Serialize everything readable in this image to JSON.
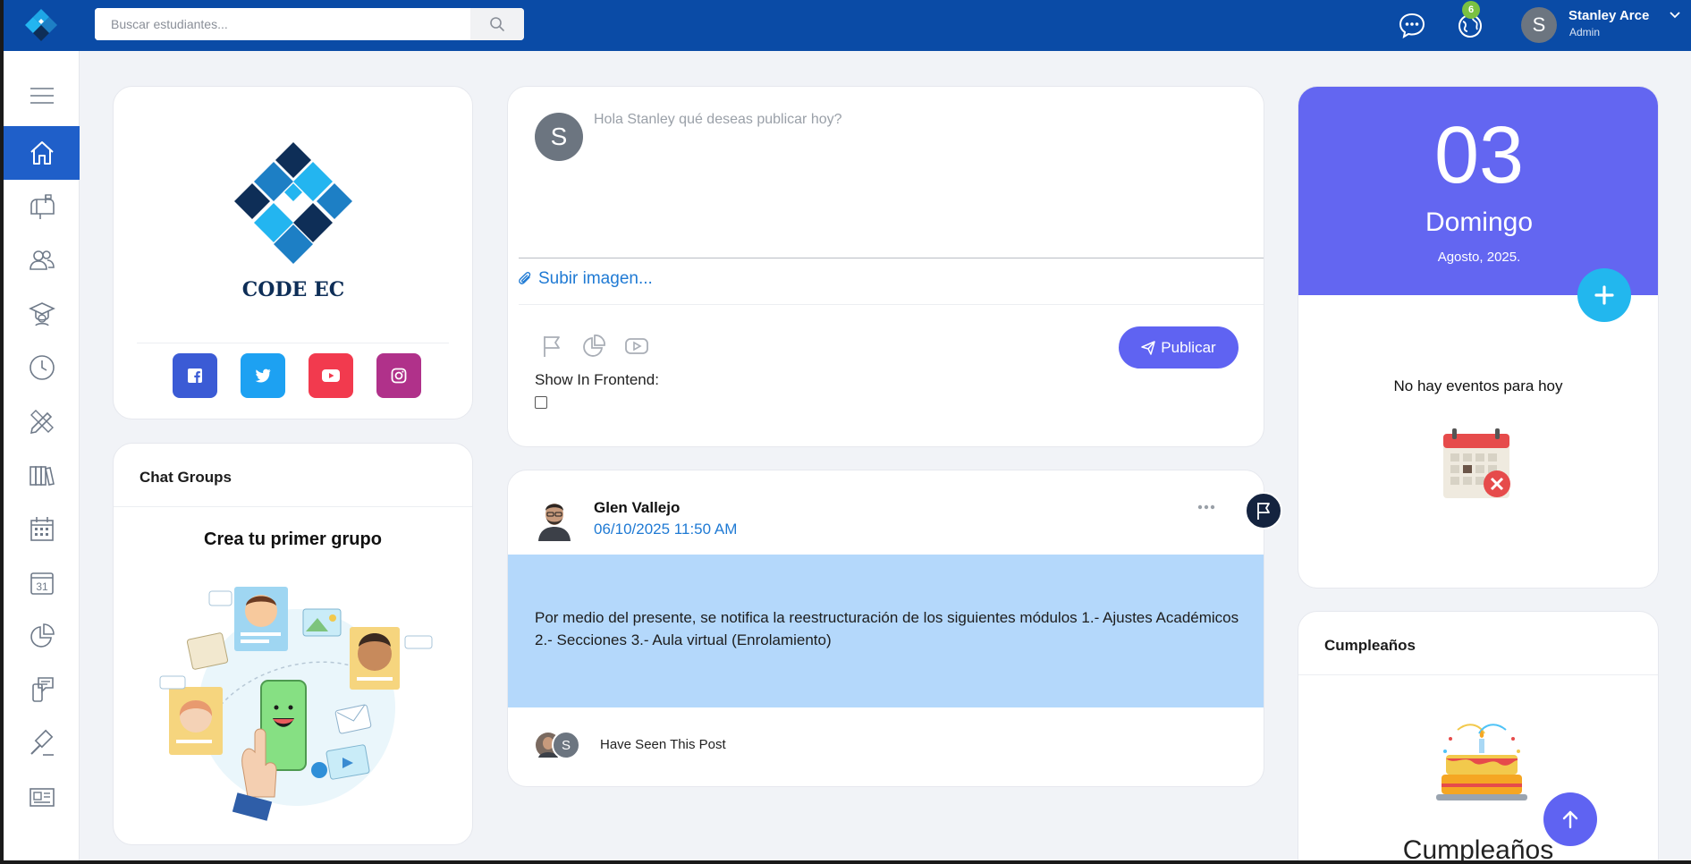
{
  "search": {
    "placeholder": "Buscar estudiantes..."
  },
  "header": {
    "notification_count": "6",
    "user": {
      "initial": "S",
      "name": "Stanley Arce",
      "role": "Admin"
    }
  },
  "sidebar": {
    "items": [
      {
        "name": "menu",
        "icon": "hamburger-icon"
      },
      {
        "name": "home",
        "icon": "home-icon",
        "active": true
      },
      {
        "name": "mailbox",
        "icon": "mailbox-icon"
      },
      {
        "name": "users",
        "icon": "users-icon"
      },
      {
        "name": "graduates",
        "icon": "graduate-icon"
      },
      {
        "name": "clock",
        "icon": "clock-icon"
      },
      {
        "name": "tools",
        "icon": "pencil-ruler-icon"
      },
      {
        "name": "library",
        "icon": "books-icon"
      },
      {
        "name": "calendar-grid",
        "icon": "calendar-grid-icon"
      },
      {
        "name": "calendar-31",
        "icon": "calendar-31-icon"
      },
      {
        "name": "reports",
        "icon": "pie-chart-icon"
      },
      {
        "name": "messages",
        "icon": "phone-chat-icon"
      },
      {
        "name": "gavel",
        "icon": "gavel-icon"
      },
      {
        "name": "news",
        "icon": "newspaper-icon"
      }
    ],
    "calendar_31_text": "31"
  },
  "brand": {
    "name": "CODE EC",
    "socials": [
      {
        "name": "facebook",
        "icon": "facebook-icon",
        "color": "#3b5bd5"
      },
      {
        "name": "twitter",
        "icon": "twitter-icon",
        "color": "#1da1f2"
      },
      {
        "name": "youtube",
        "icon": "youtube-icon",
        "color": "#f23a4e"
      },
      {
        "name": "instagram",
        "icon": "instagram-icon",
        "color": "#b0318a"
      }
    ]
  },
  "chat_groups": {
    "title": "Chat Groups",
    "subtitle": "Crea tu primer grupo"
  },
  "composer": {
    "avatar_initial": "S",
    "placeholder": "Hola Stanley qué deseas publicar hoy?",
    "upload_label": "Subir imagen...",
    "show_frontend_label": "Show In Frontend:",
    "publish_label": "Publicar"
  },
  "post": {
    "author": "Glen Vallejo",
    "date": "06/10/2025 11:50 AM",
    "body": "Por medio del presente, se notifica la reestructuración de los siguientes módulos 1.- Ajustes Académicos 2.- Secciones 3.- Aula virtual (Enrolamiento)",
    "seen_label": "Have Seen This Post",
    "seen_initial": "S"
  },
  "calendar": {
    "day": "03",
    "weekday": "Domingo",
    "month_year": "Agosto, 2025.",
    "empty_label": "No hay eventos para hoy"
  },
  "birthdays": {
    "title": "Cumpleaños",
    "big_label": "Cumpleaños"
  },
  "colors": {
    "topbar": "#0a4ba6",
    "accent": "#5f63f2",
    "calendar": "#6366f1",
    "link": "#1f7ad4",
    "post_bg": "#b4d8fb"
  }
}
